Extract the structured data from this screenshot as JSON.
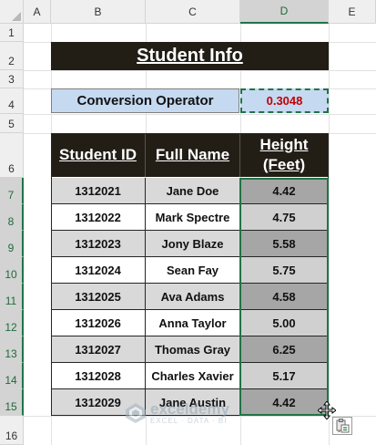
{
  "columns": [
    "A",
    "B",
    "C",
    "D",
    "E"
  ],
  "rows": [
    "1",
    "2",
    "3",
    "4",
    "5",
    "6",
    "7",
    "8",
    "9",
    "10",
    "11",
    "12",
    "13",
    "14",
    "15",
    "16"
  ],
  "title": "Student Info",
  "conversion": {
    "label": "Conversion Operator",
    "value": "0.3048"
  },
  "table": {
    "headers": [
      "Student ID",
      "Full Name",
      "Height (Feet)"
    ],
    "rows": [
      {
        "id": "1312021",
        "name": "Jane Doe",
        "height": "4.42"
      },
      {
        "id": "1312022",
        "name": "Mark Spectre",
        "height": "4.75"
      },
      {
        "id": "1312023",
        "name": "Jony Blaze",
        "height": "5.58"
      },
      {
        "id": "1312024",
        "name": "Sean Fay",
        "height": "5.75"
      },
      {
        "id": "1312025",
        "name": "Ava Adams",
        "height": "4.58"
      },
      {
        "id": "1312026",
        "name": "Anna Taylor",
        "height": "5.00"
      },
      {
        "id": "1312027",
        "name": "Thomas Gray",
        "height": "6.25"
      },
      {
        "id": "1312028",
        "name": "Charles Xavier",
        "height": "5.17"
      },
      {
        "id": "1312029",
        "name": "Jane Austin",
        "height": "4.42"
      }
    ]
  },
  "watermark": {
    "name": "exceldemy",
    "tagline": "EXCEL · DATA · BI"
  },
  "colors": {
    "header_bg": "#221e16",
    "conversion_bg": "#c5d9f1",
    "conversion_value": "#c00000",
    "selection": "#217346",
    "stripe_light": "#d9d9d9",
    "stripe_white": "#ffffff",
    "selected_shade": "#a6a6a6"
  },
  "icons": {
    "corner": "select-all-icon",
    "cursor": "move-cursor-icon",
    "paste": "paste-options-icon"
  }
}
